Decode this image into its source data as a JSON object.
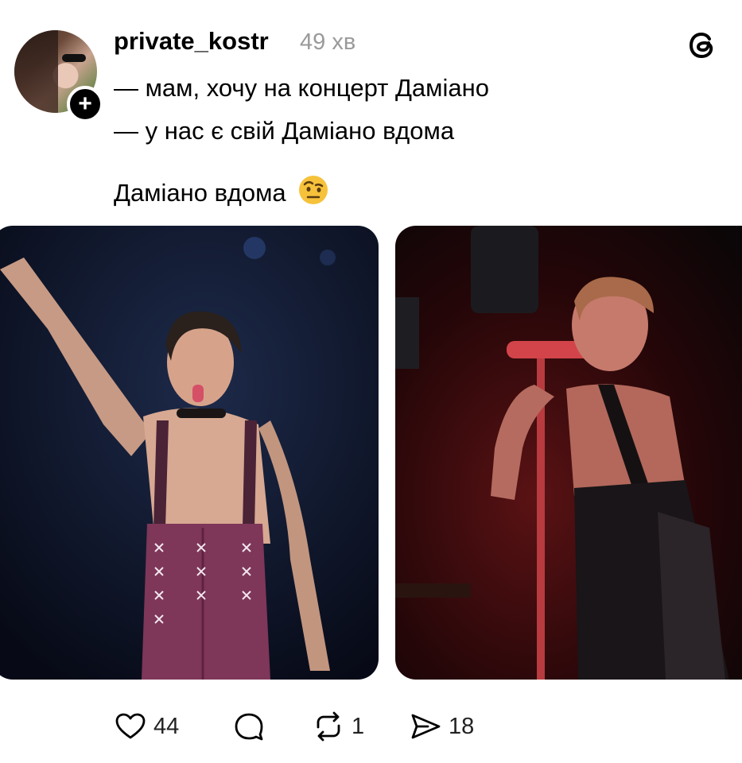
{
  "post": {
    "username": "private_kostr",
    "time": "49 хв",
    "text_line_1": "— мам, хочу на концерт Даміано",
    "text_line_2": "— у нас є свій Даміано вдома",
    "text_line_3": "Даміано вдома",
    "emoji": "face-with-raised-eyebrow-emoji"
  },
  "actions": {
    "likes": "44",
    "comments": "",
    "reposts": "1",
    "shares": "18"
  },
  "icons": {
    "app_logo": "threads-logo-icon",
    "follow": "plus-icon",
    "like": "heart-icon",
    "comment": "comment-bubble-icon",
    "repost": "repost-icon",
    "share": "send-icon"
  },
  "colors": {
    "text": "#000000",
    "muted": "#9a9a9a",
    "background": "#ffffff"
  }
}
